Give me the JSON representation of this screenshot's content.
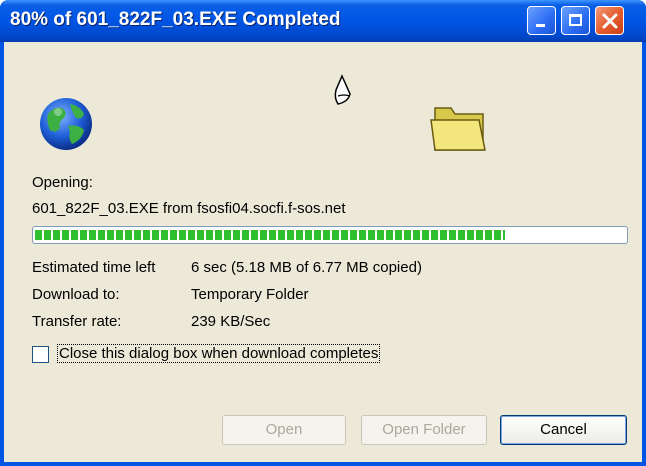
{
  "window": {
    "title": "80% of 601_822F_03.EXE Completed",
    "accent": "#0054e3"
  },
  "icons": {
    "globe": "globe-icon",
    "paper": "flying-paper-icon",
    "folder": "folder-icon"
  },
  "status": {
    "opening_label": "Opening:",
    "file_line": "601_822F_03.EXE from fsosfi04.socfi.f-sos.net"
  },
  "progress": {
    "percent": 80
  },
  "details": {
    "time_left_label": "Estimated time left",
    "time_left_value": "6 sec (5.18 MB of 6.77 MB copied)",
    "download_to_label": "Download to:",
    "download_to_value": "Temporary Folder",
    "transfer_rate_label": "Transfer rate:",
    "transfer_rate_value": "239 KB/Sec"
  },
  "checkbox": {
    "label": "Close this dialog box when download completes",
    "checked": false
  },
  "buttons": {
    "open": "Open",
    "open_folder": "Open Folder",
    "cancel": "Cancel"
  }
}
